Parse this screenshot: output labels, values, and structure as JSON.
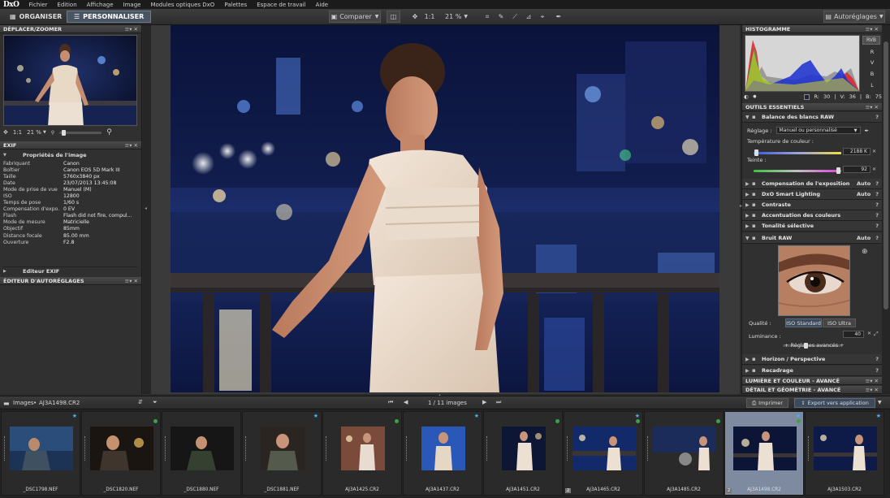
{
  "menubar": {
    "logo": "DxO",
    "items": [
      "Fichier",
      "Edition",
      "Affichage",
      "Image",
      "Modules optiques DxO",
      "Palettes",
      "Espace de travail",
      "Aide"
    ]
  },
  "toolbar": {
    "tab_organiser": "ORGANISER",
    "tab_personnaliser": "PERSONNALISER",
    "compare_label": "Comparer",
    "zoom_1to1": "1:1",
    "zoom_percent": "21 %",
    "autoreglages_label": "Autoréglages"
  },
  "left": {
    "nav_title": "DÉPLACER/ZOOMER",
    "zoom_1to1": "1:1",
    "zoom_percent": "21 %",
    "exif_title": "EXIF",
    "props_title": "Propriétés de l'image",
    "exif_rows": [
      {
        "k": "Fabriquant",
        "v": "Canon"
      },
      {
        "k": "Boîtier",
        "v": "Canon EOS 5D Mark III"
      },
      {
        "k": "Taille",
        "v": "5760x3840 px"
      },
      {
        "k": "Date",
        "v": "23/07/2013 13:45:08"
      },
      {
        "k": "Mode de prise de vue",
        "v": "Manuel (M)"
      },
      {
        "k": "ISO",
        "v": "12800"
      },
      {
        "k": "Temps de pose",
        "v": "1/60 s"
      },
      {
        "k": "Compensation d'expo.",
        "v": "0 EV"
      },
      {
        "k": "Flash",
        "v": "Flash did not fire, compul..."
      },
      {
        "k": "Mode de mesure",
        "v": "Matricielle"
      },
      {
        "k": "Objectif",
        "v": "85mm"
      },
      {
        "k": "Distance focale",
        "v": "85.00 mm"
      },
      {
        "k": "Ouverture",
        "v": "F2.8"
      }
    ],
    "editeur_exif": "Editeur EXIF",
    "editeur_autoreglages": "ÉDITEUR D'AUTORÉGLAGES"
  },
  "right": {
    "histo_title": "HISTOGRAMME",
    "channels": [
      "RVB",
      "R",
      "V",
      "B",
      "L"
    ],
    "readout": {
      "r_label": "R:",
      "r": "30",
      "v_label": "V:",
      "v": "36",
      "b_label": "B:",
      "b": "75"
    },
    "tools_title": "OUTILS ESSENTIELS",
    "wb_title": "Balance des blancs RAW",
    "reglage_label": "Réglage :",
    "reglage_value": "Manuel ou personnalisé",
    "temp_label": "Température de couleur :",
    "temp_value": "2188 K",
    "teinte_label": "Teinte :",
    "teinte_value": "92",
    "temp_level": 0.03,
    "teinte_level": 0.97,
    "sections": [
      {
        "name": "Compensation de l'exposition",
        "auto": "Auto"
      },
      {
        "name": "DxO Smart Lighting",
        "auto": "Auto"
      },
      {
        "name": "Contraste",
        "auto": ""
      },
      {
        "name": "Accentuation des couleurs",
        "auto": ""
      },
      {
        "name": "Tonalité sélective",
        "auto": ""
      }
    ],
    "bruit_title": "Bruit RAW",
    "bruit_auto": "Auto",
    "qualite_label": "Qualité :",
    "iso_standard": "ISO Standard",
    "iso_ultra": "ISO Ultra",
    "luminance_label": "Luminance :",
    "luminance_value": "40",
    "luminance_level": 0.4,
    "advanced": "+ Réglages avancés +",
    "sections2": [
      {
        "name": "Horizon / Perspective"
      },
      {
        "name": "Recadrage"
      }
    ],
    "group1": "LUMIÈRE ET COULEUR - AVANCÉ",
    "group2": "DÉTAIL ET GÉOMÉTRIE - AVANCÉ",
    "auto_label": "Auto",
    "help": "?"
  },
  "filmhead": {
    "images_label": "Images",
    "path": "AJ3A1498.CR2",
    "counter": "1 / 11 images",
    "print_label": "Imprimer",
    "export_label": "Export vers application"
  },
  "film": [
    {
      "name": "_DSC1798.NEF",
      "num": ""
    },
    {
      "name": "_DSC1820.NEF",
      "num": ""
    },
    {
      "name": "_DSC1880.NEF",
      "num": ""
    },
    {
      "name": "_DSC1881.NEF",
      "num": ""
    },
    {
      "name": "AJ3A1425.CR2",
      "num": ""
    },
    {
      "name": "AJ3A1437.CR2",
      "num": ""
    },
    {
      "name": "AJ3A1451.CR2",
      "num": ""
    },
    {
      "name": "AJ3A1465.CR2",
      "num": "2"
    },
    {
      "name": "AJ3A1485.CR2",
      "num": ""
    },
    {
      "name": "AJ3A1498.CR2",
      "num": "2"
    },
    {
      "name": "AJ3A1503.CR2",
      "num": ""
    }
  ]
}
